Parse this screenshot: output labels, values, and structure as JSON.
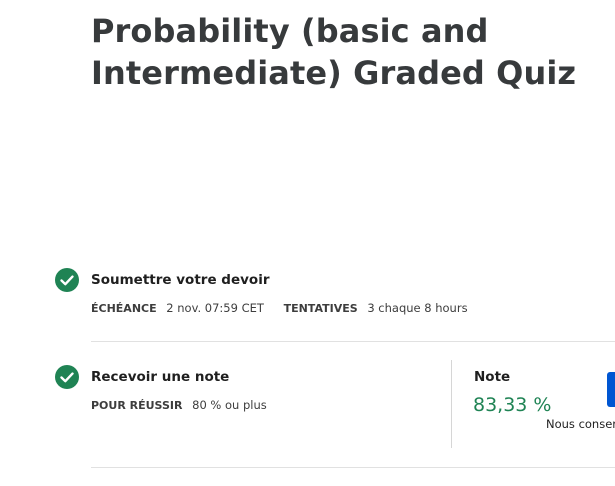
{
  "title": "Probability (basic and Intermediate) Graded Quiz",
  "steps": [
    {
      "title": "Soumettre votre devoir",
      "due_label": "ÉCHÉANCE",
      "due_value": "2 nov. 07:59 CET",
      "attempts_label": "TENTATIVES",
      "attempts_value": "3 chaque 8  hours"
    },
    {
      "title": "Recevoir une note",
      "pass_label": "POUR RÉUSSIR",
      "pass_value": "80 % ou plus"
    }
  ],
  "grade": {
    "label": "Note",
    "value": "83,33 %",
    "sub": "Nous conser"
  },
  "colors": {
    "success": "#1f8354",
    "primary": "#0056d2"
  }
}
